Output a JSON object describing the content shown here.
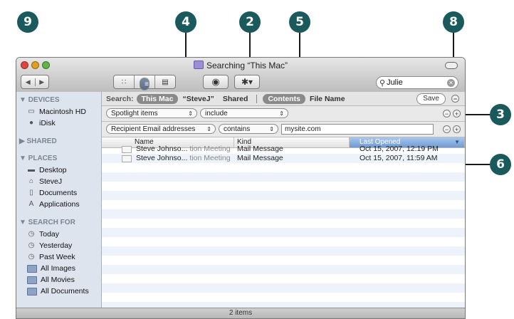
{
  "callouts": [
    "9",
    "4",
    "2",
    "5",
    "8",
    "3",
    "6"
  ],
  "window": {
    "title": "Searching “This Mac”"
  },
  "toolbar": {
    "back_icon": "◀",
    "forward_icon": "▶",
    "view_icons": [
      "∷",
      "≡",
      "▥",
      "▤"
    ],
    "eye_icon": "◉",
    "gear_icon": "✱▾",
    "search_value": "Julie"
  },
  "sidebar": {
    "devices_header": "▼ DEVICES",
    "devices": [
      "Macintosh HD",
      "iDisk"
    ],
    "shared_header": "▶ SHARED",
    "places_header": "▼ PLACES",
    "places": [
      "Desktop",
      "SteveJ",
      "Documents",
      "Applications"
    ],
    "search_header": "▼ SEARCH FOR",
    "search_for": [
      "Today",
      "Yesterday",
      "Past Week",
      "All Images",
      "All Movies",
      "All Documents"
    ]
  },
  "scope": {
    "label": "Search:",
    "this_mac": "This Mac",
    "stevej": "“SteveJ”",
    "shared": "Shared",
    "contents": "Contents",
    "file_name": "File Name",
    "save": "Save"
  },
  "criteria": [
    {
      "attribute": "Spotlight items",
      "operator": "include",
      "value": ""
    },
    {
      "attribute": "Recipient Email addresses",
      "operator": "contains",
      "value": "mysite.com"
    }
  ],
  "columns": {
    "name": "Name",
    "kind": "Kind",
    "last_opened": "Last Opened"
  },
  "results": [
    {
      "name_a": "Steve Johnso...",
      "name_b": "tion Meeting",
      "kind": "Mail Message",
      "opened": "Oct 15, 2007, 12:19 PM"
    },
    {
      "name_a": "Steve Johnso...",
      "name_b": "tion Meeting",
      "kind": "Mail Message",
      "opened": "Oct 15, 2007, 11:59 AM"
    }
  ],
  "status": "2 items",
  "colors": {
    "callout": "#1a5a5c",
    "sidebar_bg": "#dde4ed",
    "selected_column": "#6f9bd3"
  }
}
